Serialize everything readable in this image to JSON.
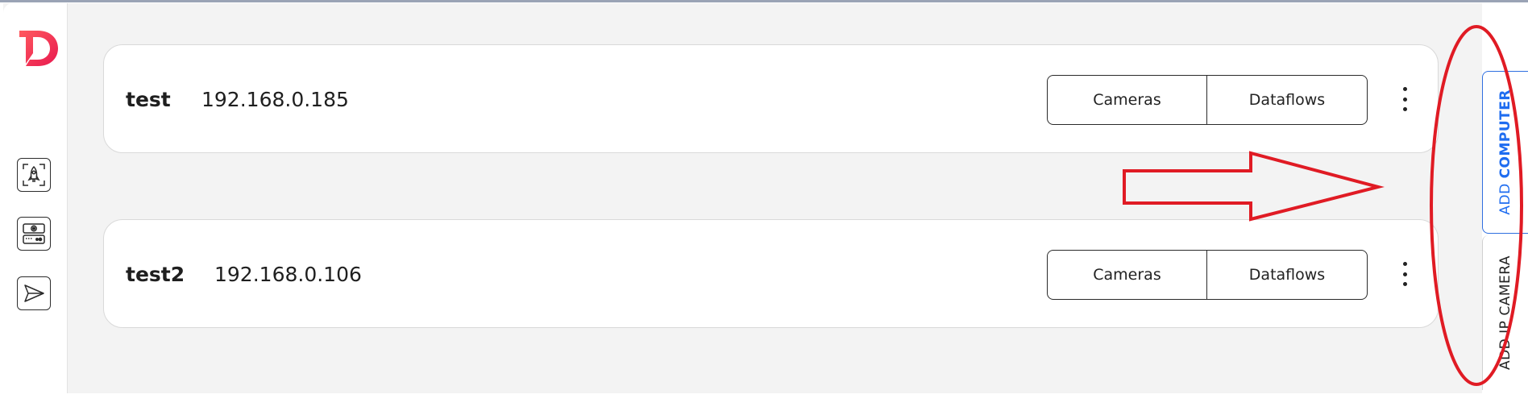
{
  "app": {
    "logo_letter": "D",
    "brand_color": "#f23a5e",
    "accent_color": "#1e6cf0"
  },
  "sidebar": {
    "items": [
      {
        "name": "deploy",
        "icon": "rocket-icon"
      },
      {
        "name": "cameras",
        "icon": "camera-device-icon"
      },
      {
        "name": "send",
        "icon": "send-icon"
      }
    ]
  },
  "computers": [
    {
      "name": "test",
      "ip": "192.168.0.185",
      "cameras_label": "Cameras",
      "dataflows_label": "Dataflows",
      "menu_icon": "more-vertical-icon"
    },
    {
      "name": "test2",
      "ip": "192.168.0.106",
      "cameras_label": "Cameras",
      "dataflows_label": "Dataflows",
      "menu_icon": "more-vertical-icon"
    }
  ],
  "right_panel": {
    "add_computer": {
      "prefix": "ADD ",
      "highlight": "COMPUTER"
    },
    "add_ip_camera": {
      "label": "ADD IP CAMERA"
    }
  },
  "annotations": {
    "color": "#e01b24",
    "shapes": [
      "arrow",
      "ellipse"
    ]
  }
}
